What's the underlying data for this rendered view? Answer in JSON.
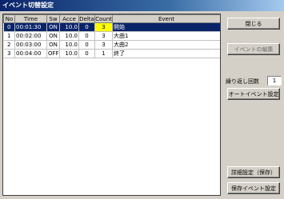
{
  "window": {
    "title": "イベント切替設定"
  },
  "table": {
    "headers": [
      "No",
      "Time",
      "Sw",
      "Acce",
      "Delta",
      "Count",
      "Event"
    ],
    "rows": [
      [
        "0",
        "00:01:30",
        "ON",
        "10.0",
        "0",
        "3",
        "開始"
      ],
      [
        "1",
        "00:02:00",
        "ON",
        "10.0",
        "0",
        "3",
        "大曲1"
      ],
      [
        "2",
        "00:03:00",
        "ON",
        "10.0",
        "0",
        "3",
        "大曲2"
      ],
      [
        "3",
        "00:04:00",
        "OFF",
        "10.0",
        "0",
        "1",
        "終了"
      ]
    ],
    "selected_row": 0,
    "highlight_cell": {
      "row": 0,
      "col": 5
    }
  },
  "buttons": {
    "close": "閉じる",
    "event_edit": "イベントの編集",
    "advance_setting": "オートイベント設定",
    "detail_setting": "詳細設定（保存）",
    "save_event": "保存イベント設定"
  },
  "controls": {
    "spin_label": "繰り返し回数",
    "spin_value": "1"
  },
  "colors": {
    "selection": "#0a246a",
    "highlight": "#ffff00"
  }
}
